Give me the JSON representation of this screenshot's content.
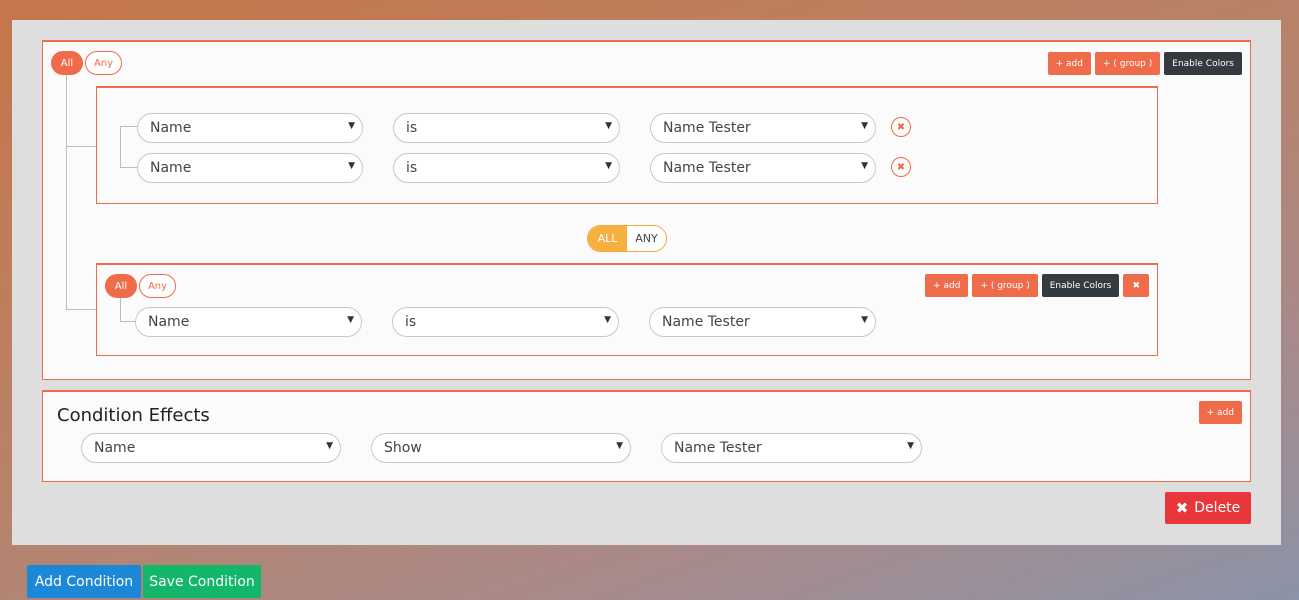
{
  "colors": {
    "accent": "#ef6c4a",
    "dark": "#343a40",
    "toggle": "#f7b040",
    "danger": "#e8363b",
    "primary": "#1e88d8",
    "success": "#12b76a"
  },
  "group1": {
    "all_label": "All",
    "any_label": "Any",
    "add_label": "+ add",
    "group_label": "+ ( group )",
    "colors_label": "Enable Colors",
    "rules": [
      {
        "field": "Name",
        "operator": "is",
        "value": "Name Tester"
      },
      {
        "field": "Name",
        "operator": "is",
        "value": "Name Tester"
      }
    ]
  },
  "connector": {
    "all_label": "ALL",
    "any_label": "ANY",
    "selected": "ALL"
  },
  "group2": {
    "all_label": "All",
    "any_label": "Any",
    "add_label": "+ add",
    "group_label": "+ ( group )",
    "colors_label": "Enable Colors",
    "remove_icon": "✖",
    "rules": [
      {
        "field": "Name",
        "operator": "is",
        "value": "Name Tester"
      }
    ]
  },
  "effects": {
    "title": "Condition Effects",
    "add_label": "+ add",
    "field": "Name",
    "action": "Show",
    "value": "Name Tester"
  },
  "delete_label": "Delete",
  "footer": {
    "add_condition": "Add Condition",
    "save_condition": "Save Condition"
  }
}
